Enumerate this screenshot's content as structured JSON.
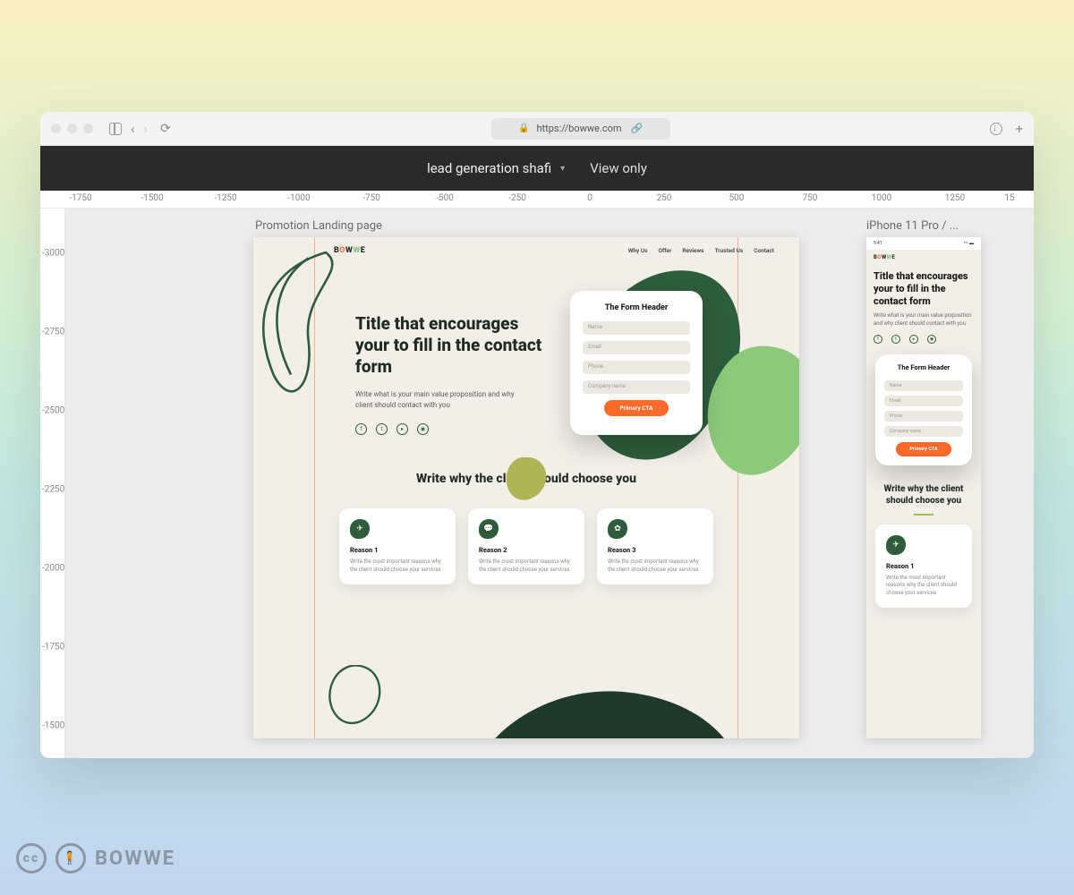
{
  "browser": {
    "url": "https://bowwe.com"
  },
  "app": {
    "doc_title": "lead generation shafi",
    "mode": "View only"
  },
  "ruler_top": [
    "-1750",
    "-1500",
    "-1250",
    "-1000",
    "-750",
    "-500",
    "-250",
    "0",
    "250",
    "500",
    "750",
    "1000",
    "1250",
    "15"
  ],
  "ruler_top_pos": [
    45,
    125,
    207,
    289,
    370,
    452,
    533,
    614,
    697,
    778,
    860,
    940,
    1022,
    1083
  ],
  "ruler_left": [
    "-3000",
    "-2750",
    "-2500",
    "-2250",
    "-2000",
    "-1750",
    "-1500"
  ],
  "ruler_left_pos": [
    50,
    138,
    226,
    314,
    402,
    490,
    578
  ],
  "frames": {
    "desktop_label": "Promotion Landing page",
    "mobile_label": "iPhone 11 Pro / ..."
  },
  "mockup": {
    "logo": "BOWWE",
    "nav": [
      "Why Us",
      "Offer",
      "Reviews",
      "Trusted Us",
      "Contact"
    ],
    "hero_title": "Title that encourages your to fill in the contact form",
    "hero_sub": "Write what is your main value proposition and why client should contact with you",
    "form_header": "The Form Header",
    "fields": [
      "Name",
      "Email",
      "Phone",
      "Company name"
    ],
    "cta": "Primary CTA",
    "section2_title": "Write why the client should choose you",
    "reasons": [
      {
        "title": "Reason 1",
        "text": "Write the most important reasons why the client should choose your services"
      },
      {
        "title": "Reason 2",
        "text": "Write the most important reasons why the client should choose your services"
      },
      {
        "title": "Reason 3",
        "text": "Write the most important reasons why the client should choose your services"
      }
    ],
    "mobile_statusbar_time": "9:41"
  },
  "watermark": "BOWWE"
}
